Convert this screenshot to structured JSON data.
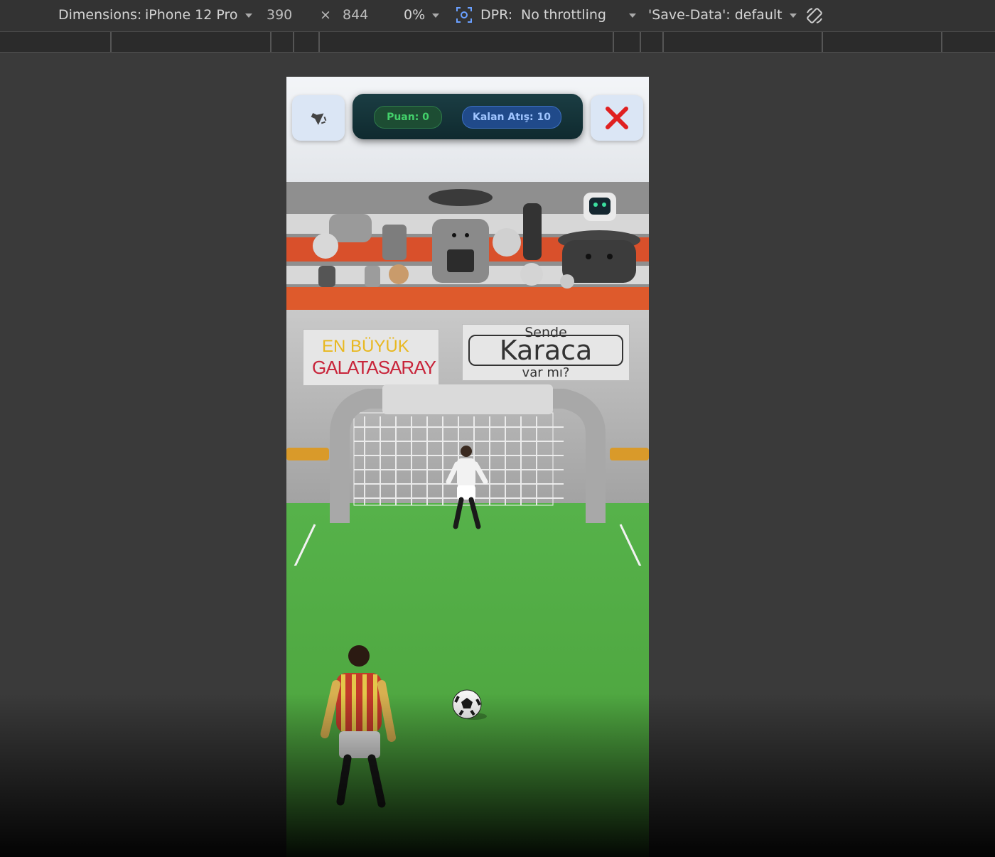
{
  "toolbar": {
    "dimensions_label": "Dimensions:",
    "device": "iPhone 12 Pro",
    "width": "390",
    "times": "×",
    "height": "844",
    "zoom": "0%",
    "dpr_label": "DPR:",
    "throttling": "No throttling",
    "save_data": "'Save-Data': default"
  },
  "game": {
    "score_label": "Puan: 0",
    "shots_label": "Kalan Atış: 10",
    "banner_left_line1": "EN BÜYÜK",
    "banner_left_line2": "GALATASARAY",
    "banner_right_top": "Sende",
    "banner_right_main": "Karaca",
    "banner_right_bottom": "var mı?",
    "icons": {
      "sound": "speaker-icon",
      "close": "close-icon",
      "rotate": "rotate-icon",
      "capture": "capture-icon"
    },
    "colors": {
      "close": "#e02020",
      "score_text": "#43d06a",
      "shots_text": "#9fc4ff"
    }
  }
}
